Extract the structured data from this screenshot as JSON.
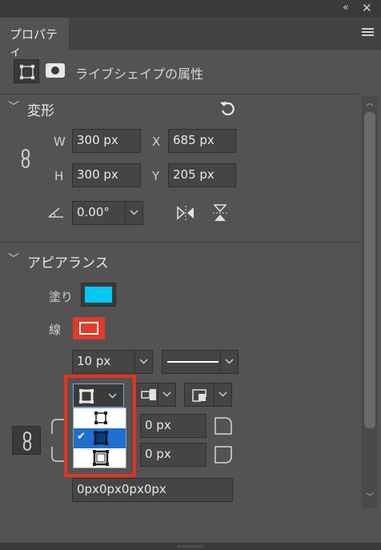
{
  "panel": {
    "tab_label": "プロパティ",
    "subtitle": "ライブシェイプの属性"
  },
  "transform": {
    "title": "変形",
    "w_label": "W",
    "w_value": "300 px",
    "h_label": "H",
    "h_value": "300 px",
    "x_label": "X",
    "x_value": "685 px",
    "y_label": "Y",
    "y_value": "205 px",
    "angle_value": "0.00°"
  },
  "appearance": {
    "title": "アピアランス",
    "fill_label": "塗り",
    "fill_color": "#00c8f0",
    "stroke_label": "線",
    "stroke_color": "#e03a2a",
    "stroke_width": "10 px",
    "align_options": [
      "inside",
      "center",
      "outside"
    ],
    "align_selected": 1,
    "corner_top_right": "0 px",
    "corner_bottom_right": "0 px",
    "corner_summary": "0px0px0px0px"
  },
  "colors": {
    "highlight": "#e8311f",
    "selected": "#1e6fd0",
    "panel_bg": "#535353"
  }
}
